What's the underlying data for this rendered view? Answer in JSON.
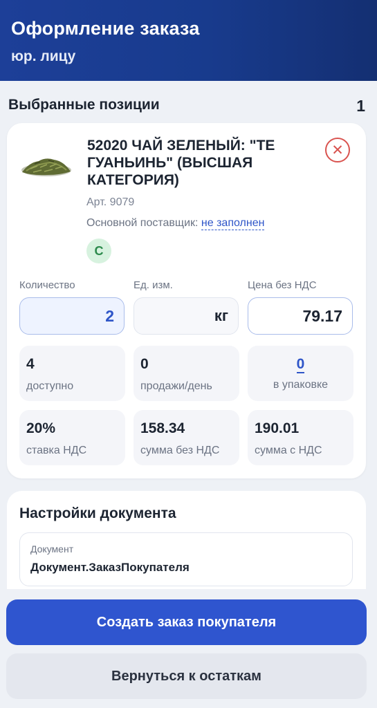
{
  "header": {
    "title": "Оформление заказа",
    "subtitle": "юр. лицу"
  },
  "selected": {
    "label": "Выбранные позиции",
    "count": "1"
  },
  "product": {
    "name": "52020 ЧАЙ ЗЕЛЕНЫЙ: \"ТЕ ГУАНЬИНЬ\" (ВЫСШАЯ КАТЕГОРИЯ)",
    "article": "Арт. 9079",
    "supplier_label": "Основной поставщик:",
    "supplier_value": "не заполнен",
    "badge": "С",
    "remove_icon": "close-circle-icon",
    "qty_label": "Количество",
    "qty_value": "2",
    "unit_label": "Ед. изм.",
    "unit_value": "кг",
    "price_label": "Цена без НДС",
    "price_value": "79.17",
    "stats": [
      {
        "value": "4",
        "caption": "доступно"
      },
      {
        "value": "0",
        "caption": "продажи/день"
      },
      {
        "value": "0",
        "caption": "в упаковке"
      },
      {
        "value": "20%",
        "caption": "ставка НДС"
      },
      {
        "value": "158.34",
        "caption": "сумма без НДС"
      },
      {
        "value": "190.01",
        "caption": "сумма с НДС"
      }
    ]
  },
  "doc_settings": {
    "title": "Настройки документа",
    "doc_label": "Документ",
    "doc_value": "Документ.ЗаказПокупателя"
  },
  "actions": {
    "create": "Создать заказ покупателя",
    "back": "Вернуться к остаткам"
  },
  "colors": {
    "header": "#1d3f98",
    "primary_button": "#2f55cf",
    "accent": "#2e55c8",
    "remove": "#d9534f",
    "badge_bg": "#d7f2df"
  }
}
